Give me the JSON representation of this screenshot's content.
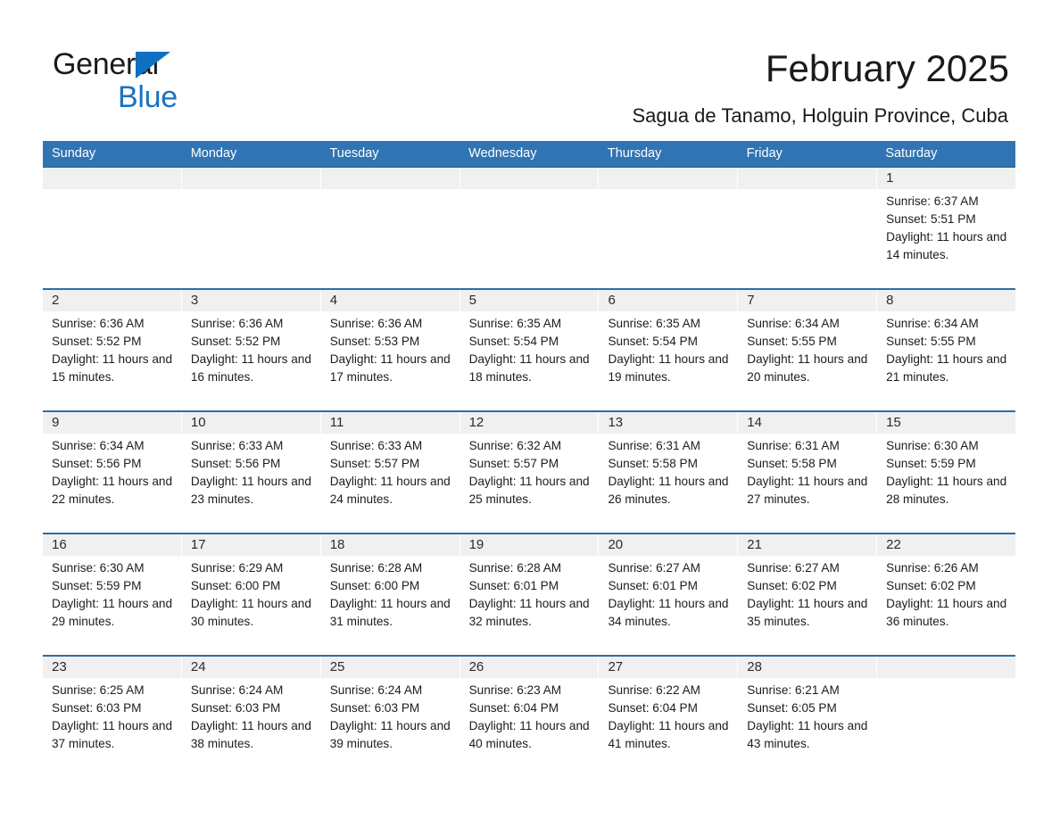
{
  "brand": {
    "name_part1": "General",
    "name_part2": "Blue",
    "accent_color": "#1a72c4",
    "triangle_color": "#0f6fc0"
  },
  "header": {
    "title": "February 2025",
    "subtitle": "Sagua de Tanamo, Holguin Province, Cuba"
  },
  "theme": {
    "header_row_bg": "#3074b4",
    "week_rule": "#2e6da4",
    "daynum_band_bg": "#f0f0f0"
  },
  "weekdays": [
    "Sunday",
    "Monday",
    "Tuesday",
    "Wednesday",
    "Thursday",
    "Friday",
    "Saturday"
  ],
  "weeks": [
    [
      {
        "day": "",
        "empty": true
      },
      {
        "day": "",
        "empty": true
      },
      {
        "day": "",
        "empty": true
      },
      {
        "day": "",
        "empty": true
      },
      {
        "day": "",
        "empty": true
      },
      {
        "day": "",
        "empty": true
      },
      {
        "day": "1",
        "sunrise": "Sunrise: 6:37 AM",
        "sunset": "Sunset: 5:51 PM",
        "daylight": "Daylight: 11 hours and 14 minutes."
      }
    ],
    [
      {
        "day": "2",
        "sunrise": "Sunrise: 6:36 AM",
        "sunset": "Sunset: 5:52 PM",
        "daylight": "Daylight: 11 hours and 15 minutes."
      },
      {
        "day": "3",
        "sunrise": "Sunrise: 6:36 AM",
        "sunset": "Sunset: 5:52 PM",
        "daylight": "Daylight: 11 hours and 16 minutes."
      },
      {
        "day": "4",
        "sunrise": "Sunrise: 6:36 AM",
        "sunset": "Sunset: 5:53 PM",
        "daylight": "Daylight: 11 hours and 17 minutes."
      },
      {
        "day": "5",
        "sunrise": "Sunrise: 6:35 AM",
        "sunset": "Sunset: 5:54 PM",
        "daylight": "Daylight: 11 hours and 18 minutes."
      },
      {
        "day": "6",
        "sunrise": "Sunrise: 6:35 AM",
        "sunset": "Sunset: 5:54 PM",
        "daylight": "Daylight: 11 hours and 19 minutes."
      },
      {
        "day": "7",
        "sunrise": "Sunrise: 6:34 AM",
        "sunset": "Sunset: 5:55 PM",
        "daylight": "Daylight: 11 hours and 20 minutes."
      },
      {
        "day": "8",
        "sunrise": "Sunrise: 6:34 AM",
        "sunset": "Sunset: 5:55 PM",
        "daylight": "Daylight: 11 hours and 21 minutes."
      }
    ],
    [
      {
        "day": "9",
        "sunrise": "Sunrise: 6:34 AM",
        "sunset": "Sunset: 5:56 PM",
        "daylight": "Daylight: 11 hours and 22 minutes."
      },
      {
        "day": "10",
        "sunrise": "Sunrise: 6:33 AM",
        "sunset": "Sunset: 5:56 PM",
        "daylight": "Daylight: 11 hours and 23 minutes."
      },
      {
        "day": "11",
        "sunrise": "Sunrise: 6:33 AM",
        "sunset": "Sunset: 5:57 PM",
        "daylight": "Daylight: 11 hours and 24 minutes."
      },
      {
        "day": "12",
        "sunrise": "Sunrise: 6:32 AM",
        "sunset": "Sunset: 5:57 PM",
        "daylight": "Daylight: 11 hours and 25 minutes."
      },
      {
        "day": "13",
        "sunrise": "Sunrise: 6:31 AM",
        "sunset": "Sunset: 5:58 PM",
        "daylight": "Daylight: 11 hours and 26 minutes."
      },
      {
        "day": "14",
        "sunrise": "Sunrise: 6:31 AM",
        "sunset": "Sunset: 5:58 PM",
        "daylight": "Daylight: 11 hours and 27 minutes."
      },
      {
        "day": "15",
        "sunrise": "Sunrise: 6:30 AM",
        "sunset": "Sunset: 5:59 PM",
        "daylight": "Daylight: 11 hours and 28 minutes."
      }
    ],
    [
      {
        "day": "16",
        "sunrise": "Sunrise: 6:30 AM",
        "sunset": "Sunset: 5:59 PM",
        "daylight": "Daylight: 11 hours and 29 minutes."
      },
      {
        "day": "17",
        "sunrise": "Sunrise: 6:29 AM",
        "sunset": "Sunset: 6:00 PM",
        "daylight": "Daylight: 11 hours and 30 minutes."
      },
      {
        "day": "18",
        "sunrise": "Sunrise: 6:28 AM",
        "sunset": "Sunset: 6:00 PM",
        "daylight": "Daylight: 11 hours and 31 minutes."
      },
      {
        "day": "19",
        "sunrise": "Sunrise: 6:28 AM",
        "sunset": "Sunset: 6:01 PM",
        "daylight": "Daylight: 11 hours and 32 minutes."
      },
      {
        "day": "20",
        "sunrise": "Sunrise: 6:27 AM",
        "sunset": "Sunset: 6:01 PM",
        "daylight": "Daylight: 11 hours and 34 minutes."
      },
      {
        "day": "21",
        "sunrise": "Sunrise: 6:27 AM",
        "sunset": "Sunset: 6:02 PM",
        "daylight": "Daylight: 11 hours and 35 minutes."
      },
      {
        "day": "22",
        "sunrise": "Sunrise: 6:26 AM",
        "sunset": "Sunset: 6:02 PM",
        "daylight": "Daylight: 11 hours and 36 minutes."
      }
    ],
    [
      {
        "day": "23",
        "sunrise": "Sunrise: 6:25 AM",
        "sunset": "Sunset: 6:03 PM",
        "daylight": "Daylight: 11 hours and 37 minutes."
      },
      {
        "day": "24",
        "sunrise": "Sunrise: 6:24 AM",
        "sunset": "Sunset: 6:03 PM",
        "daylight": "Daylight: 11 hours and 38 minutes."
      },
      {
        "day": "25",
        "sunrise": "Sunrise: 6:24 AM",
        "sunset": "Sunset: 6:03 PM",
        "daylight": "Daylight: 11 hours and 39 minutes."
      },
      {
        "day": "26",
        "sunrise": "Sunrise: 6:23 AM",
        "sunset": "Sunset: 6:04 PM",
        "daylight": "Daylight: 11 hours and 40 minutes."
      },
      {
        "day": "27",
        "sunrise": "Sunrise: 6:22 AM",
        "sunset": "Sunset: 6:04 PM",
        "daylight": "Daylight: 11 hours and 41 minutes."
      },
      {
        "day": "28",
        "sunrise": "Sunrise: 6:21 AM",
        "sunset": "Sunset: 6:05 PM",
        "daylight": "Daylight: 11 hours and 43 minutes."
      },
      {
        "day": "",
        "empty": true
      }
    ]
  ]
}
